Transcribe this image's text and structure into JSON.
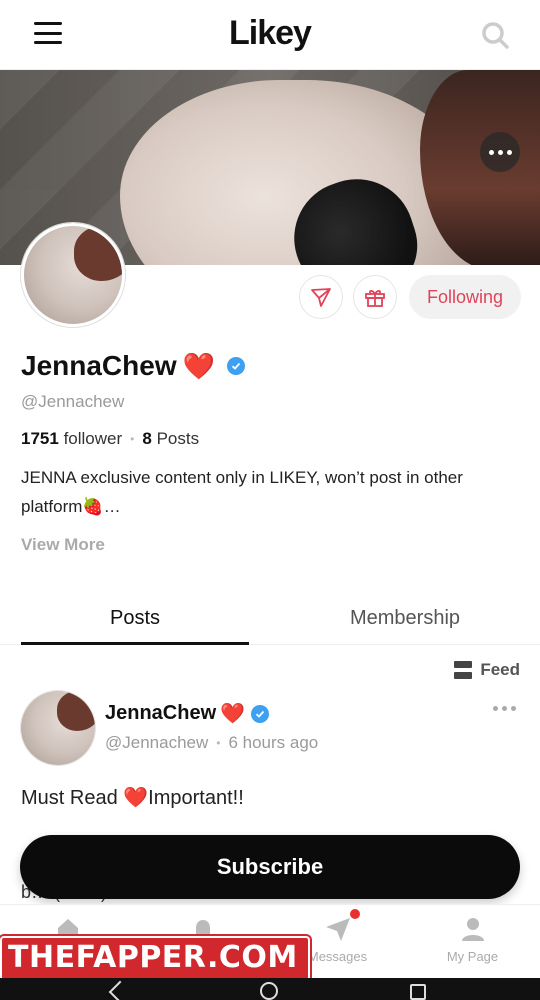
{
  "header": {
    "logo": "Likey"
  },
  "profile": {
    "name": "JennaChew",
    "name_emoji": "❤️",
    "handle": "@Jennachew",
    "follower_count": "1751",
    "follower_label": "follower",
    "posts_count": "8",
    "posts_label": "Posts",
    "bio_line1": "JENNA exclusive content only in LIKEY, won’t post in other",
    "bio_line2": "platform🍓…",
    "view_more": "View More",
    "follow_label": "Following"
  },
  "tabs": [
    {
      "label": "Posts",
      "active": true
    },
    {
      "label": "Membership",
      "active": false
    }
  ],
  "feed_toggle": {
    "label": "Feed"
  },
  "post": {
    "author": "JennaChew",
    "author_emoji": "❤️",
    "handle": "@Jennachew",
    "time": "6 hours ago",
    "text": "Must Read ❤️Important!!",
    "text_partial": "b… (… …) …"
  },
  "subscribe": {
    "label": "Subscribe"
  },
  "bottom_nav": [
    {
      "label": "Home"
    },
    {
      "label": "Notifications"
    },
    {
      "label": "Messages"
    },
    {
      "label": "My Page"
    }
  ],
  "watermark": {
    "text": "THEFAPPER.COM"
  },
  "colors": {
    "accent": "#e0445a",
    "verified": "#3ea0f0",
    "watermark": "#d1282e"
  }
}
